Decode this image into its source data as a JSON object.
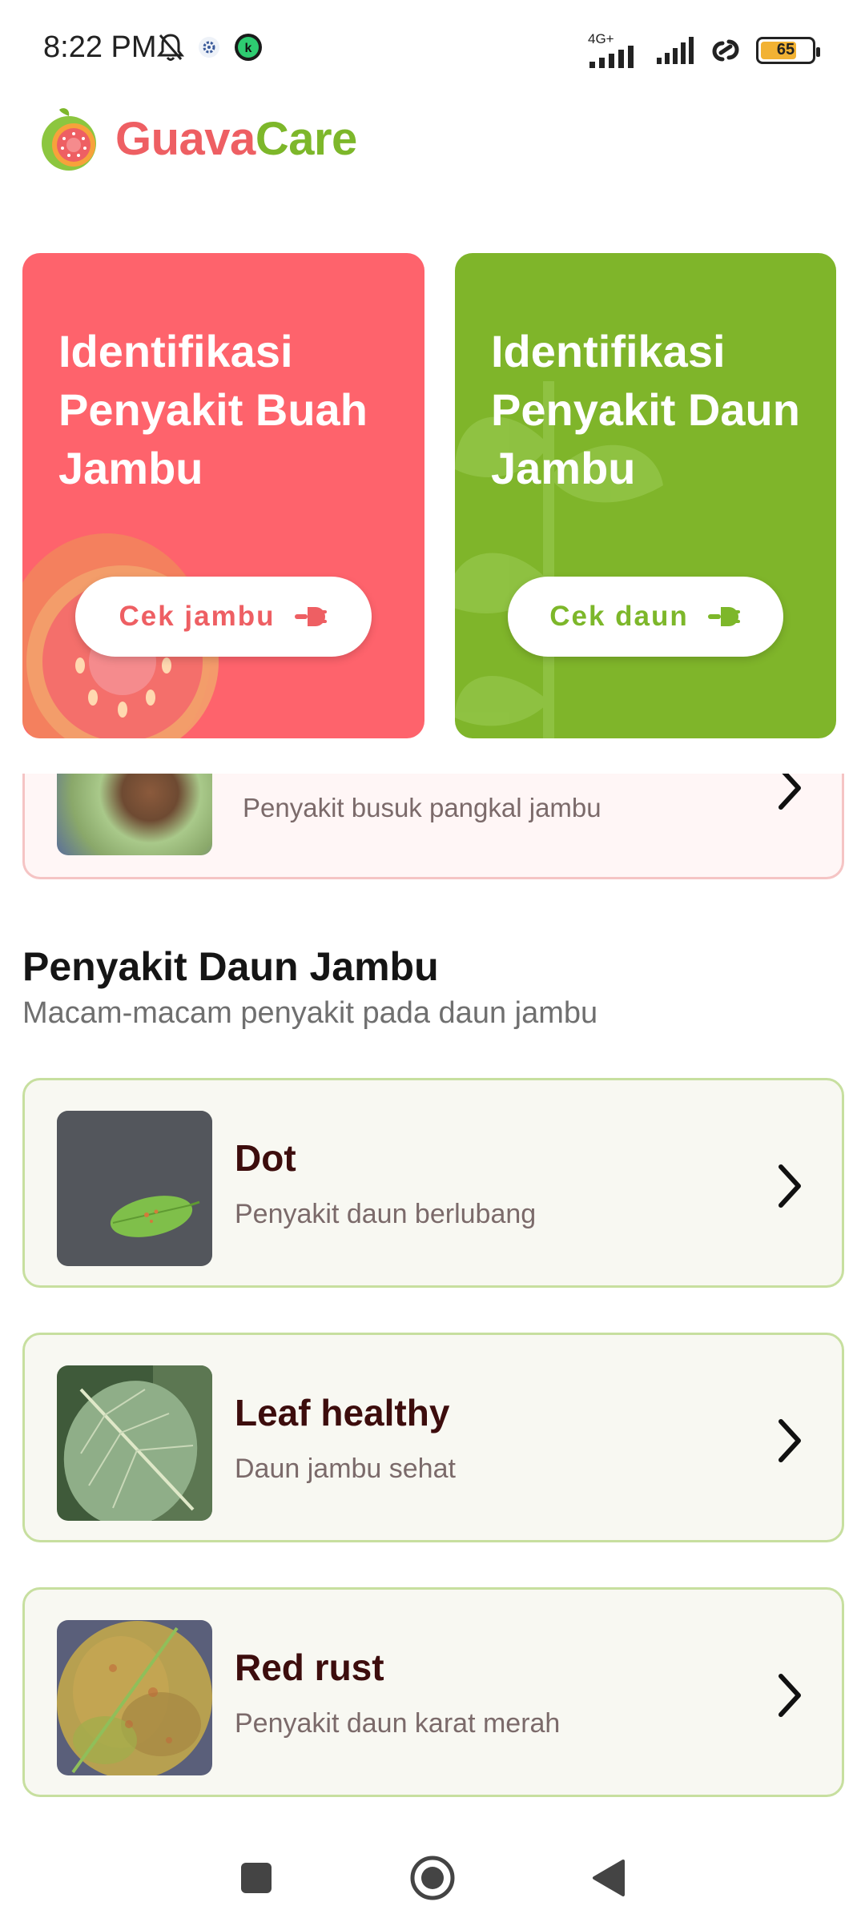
{
  "status_bar": {
    "time": "8:22 PM",
    "network": "4G+",
    "battery": "65"
  },
  "app": {
    "brand_part1": "Guava",
    "brand_part2": "Care"
  },
  "hero_cards": [
    {
      "title": "Identifikasi Penyakit Buah Jambu",
      "button": "Cek jambu",
      "color": "#fe636c"
    },
    {
      "title": "Identifikasi Penyakit Daun Jambu",
      "button": "Cek daun",
      "color": "#7fb52a"
    }
  ],
  "fruit_partial": {
    "description": "Penyakit busuk pangkal jambu"
  },
  "leaf_section": {
    "title": "Penyakit Daun Jambu",
    "subtitle": "Macam-macam penyakit pada daun jambu",
    "items": [
      {
        "name": "Dot",
        "description": "Penyakit daun berlubang"
      },
      {
        "name": "Leaf healthy",
        "description": "Daun jambu sehat"
      },
      {
        "name": "Red rust",
        "description": "Penyakit daun karat merah"
      }
    ]
  },
  "colors": {
    "accent_red": "#ee5f63",
    "accent_green": "#7db72a",
    "card_border_green": "#c7df9f",
    "card_border_red": "#f5c4c4"
  },
  "nav_icons": [
    "recent-apps-icon",
    "home-icon",
    "back-icon"
  ]
}
